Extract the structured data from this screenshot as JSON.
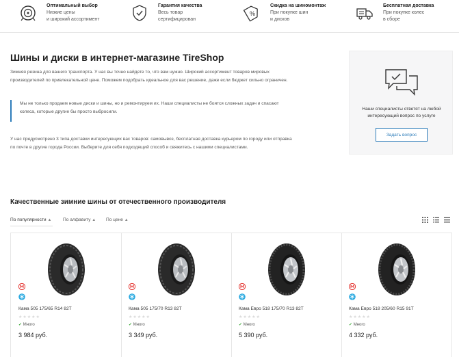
{
  "features": [
    {
      "title": "Оптимальный выбор",
      "line1": "Низкие цены",
      "line2": "и широкий ассортимент",
      "icon": "wheel-icon"
    },
    {
      "title": "Гарантия качества",
      "line1": "Весь товар",
      "line2": "сертифицирован",
      "icon": "shield-check-icon"
    },
    {
      "title": "Скидка на шиномонтаж",
      "line1": "При покупке шин",
      "line2": "и дисков",
      "icon": "discount-tag-icon"
    },
    {
      "title": "Бесплатная доставка",
      "line1": "При покупке колес",
      "line2": "в сборе",
      "icon": "truck-icon"
    }
  ],
  "main": {
    "title": "Шины и диски в интернет-магазине TireShop",
    "para1_l1": "Зимняя резина для вашего транспорта. У нас вы точно найдете то, что вам нужно. Широкий ассортимент товаров мировых",
    "para1_l2": "производителей по привлекательной цене. Поможем подобрать идеальное для вас решение, даже если бюджет сильно ограничен.",
    "quote_l1": "Мы не только продаем новые диски и шины, но и ремонтируем их. Наши специалисты не боятся сложных задач и спасают",
    "quote_l2": "колеса, которые другие бы просто выбросили.",
    "para2_l1": "У нас предусмотрено 3 типа доставки интересующих вас товаров: самовывоз, бесплатная доставка курьером по городу или  отправка",
    "para2_l2": "по почте в другие города России. Выберите для себя подходящий способ и свяжитесь с нашими специалистами."
  },
  "askbox": {
    "text_l1": "Наши специалисты ответят на любой",
    "text_l2": "интересующий вопрос по услуге",
    "button": "Задать вопрос",
    "icon": "chat-icon"
  },
  "section": {
    "title": "Качественные зимние шины от отечественного производителя",
    "sorts": [
      "По популярности",
      "По алфавиту",
      "По цене"
    ],
    "caret": "▲",
    "views": [
      "grid-view-icon",
      "compact-view-icon",
      "list-view-icon"
    ]
  },
  "products": [
    {
      "name": "Кама 505 175/65 R14 82T",
      "stock": "Много",
      "price": "3 984 руб.",
      "stars": "★★★★★"
    },
    {
      "name": "Кама 505 175/70 R13 82T",
      "stock": "Много",
      "price": "3 349 руб.",
      "stars": "★★★★★"
    },
    {
      "name": "Кама Евро 518 175/70 R13 82T",
      "stock": "Много",
      "price": "5 390 руб.",
      "stars": "★★★★★"
    },
    {
      "name": "Кама Евро 518 205/60 R15 91T",
      "stock": "Много",
      "price": "4 332 руб.",
      "stars": "★★★★★"
    }
  ],
  "colors": {
    "accent": "#2b7bb9",
    "badge_red": "#e53935",
    "snow_blue": "#29a9e0",
    "stock_green": "#3aaa35"
  }
}
